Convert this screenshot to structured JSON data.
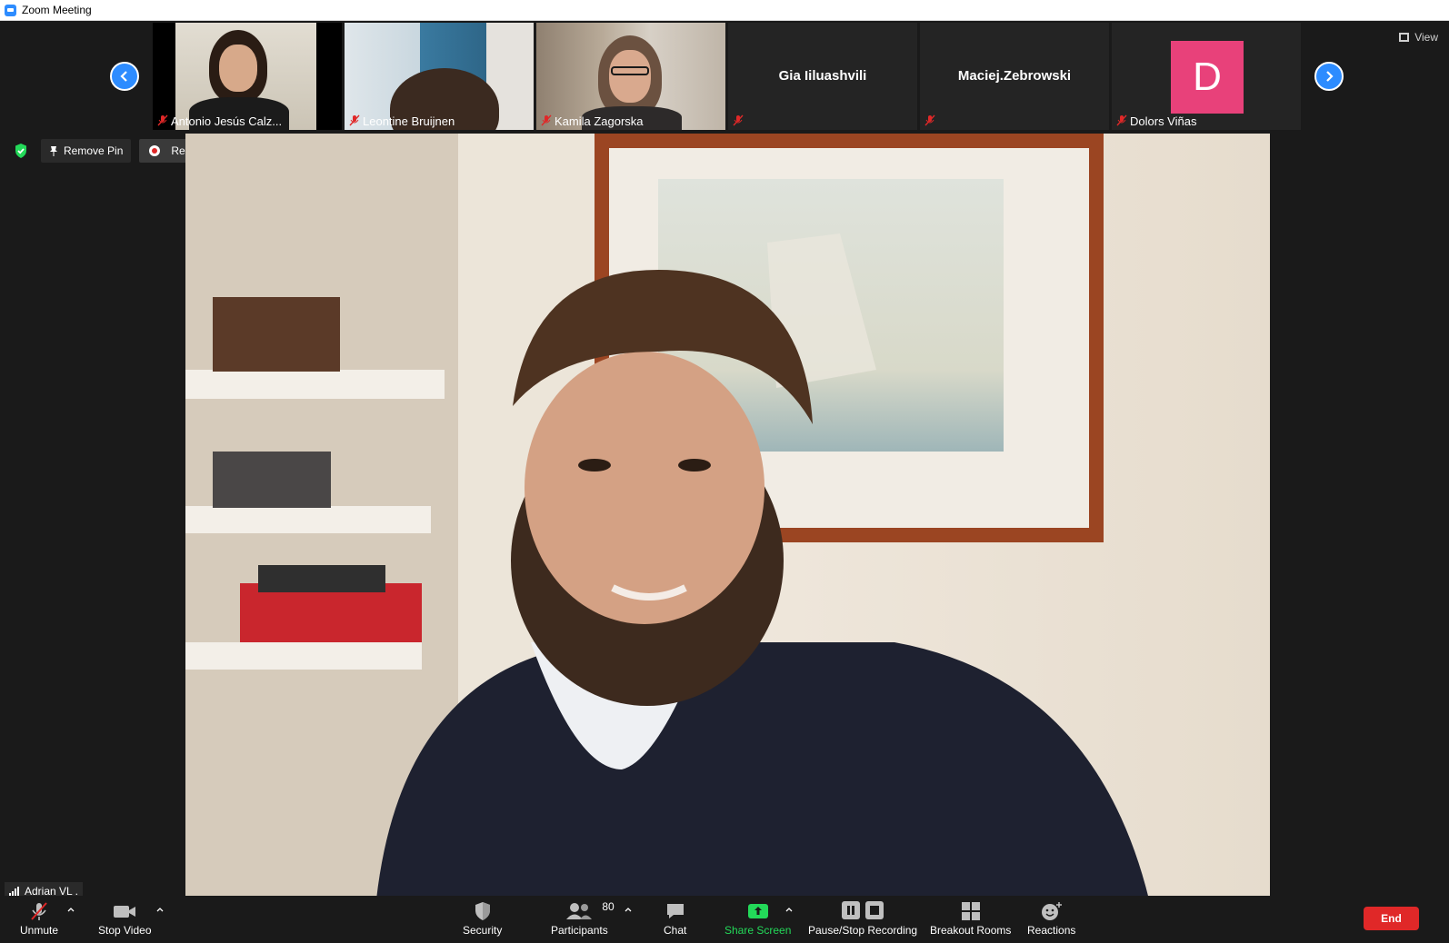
{
  "window": {
    "title": "Zoom Meeting"
  },
  "top_right": {
    "view_label": "View"
  },
  "participants_strip": [
    {
      "name": "Antonio Jesús Calz...",
      "video": true
    },
    {
      "name": "Leontine Bruijnen",
      "video": true
    },
    {
      "name": "Kamila Zagorska",
      "video": true
    },
    {
      "name": "Gia Iiluashvili",
      "video": false
    },
    {
      "name": "Maciej.Zebrowski",
      "video": false
    },
    {
      "name": "Dolors Viñas",
      "video": false,
      "avatar_letter": "D",
      "avatar_color": "#e8417a"
    }
  ],
  "pin_bar": {
    "remove_pin_label": "Remove Pin",
    "recording_label": "Recording..."
  },
  "self_view": {
    "name": "Adrian VL ."
  },
  "toolbar": {
    "unmute_label": "Unmute",
    "stop_video_label": "Stop Video",
    "security_label": "Security",
    "participants_label": "Participants",
    "participants_count": "80",
    "chat_label": "Chat",
    "share_screen_label": "Share Screen",
    "pause_stop_recording_label": "Pause/Stop Recording",
    "breakout_rooms_label": "Breakout Rooms",
    "reactions_label": "Reactions",
    "end_label": "End"
  },
  "colors": {
    "accent": "#2d8cff",
    "share_green": "#23d959",
    "end_red": "#e02828",
    "shield_green": "#23d959"
  }
}
